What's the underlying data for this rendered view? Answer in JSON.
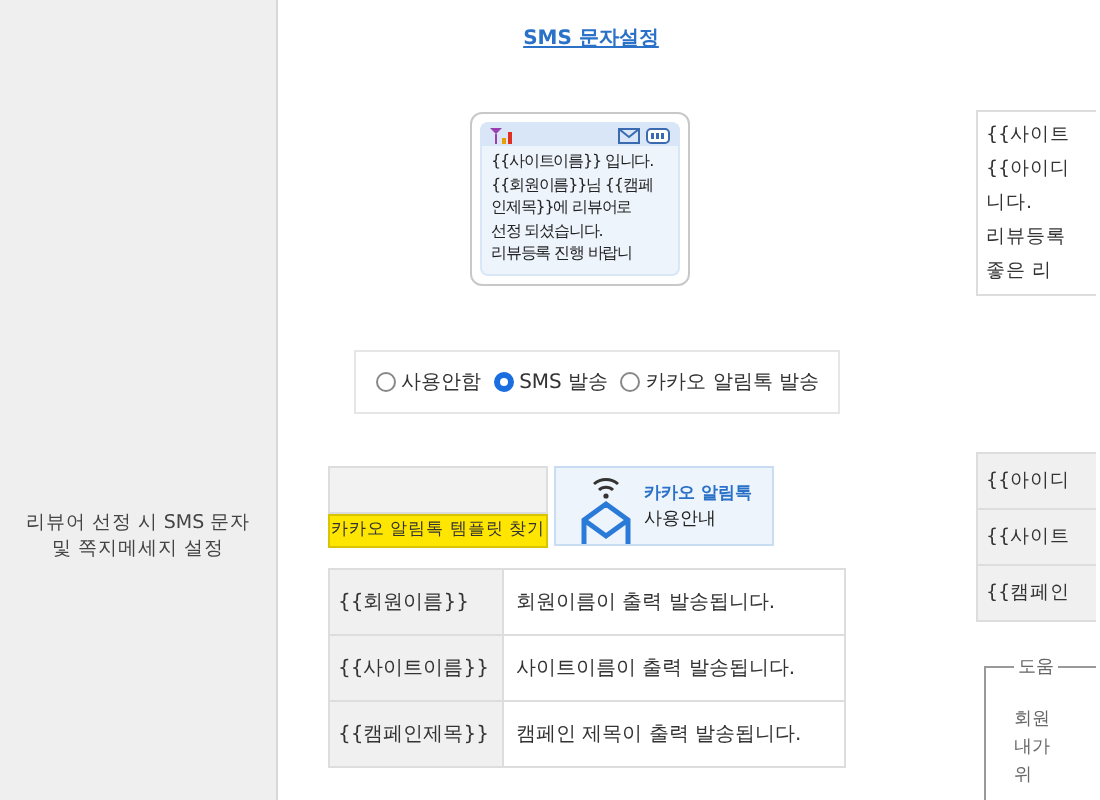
{
  "row_label": "리뷰어 선정 시 SMS 문자\n및 쪽지메세지 설정",
  "title": "SMS 문자설정",
  "sms_message": "{{사이트이름}} 입니다.\n{{회원이름}}님 {{캠페\n인제목}}에 리뷰어로\n선정 되셨습니다.\n리뷰등록 진행 바랍니",
  "send_options": [
    {
      "label": "사용안함",
      "selected": false
    },
    {
      "label": "SMS 발송",
      "selected": true
    },
    {
      "label": "카카오 알림톡 발송",
      "selected": false
    }
  ],
  "kakao_template_button": "카카오 알림톡 템플릿 찾기",
  "kakao_guide": {
    "title": "카카오 알림톡",
    "subtitle": "사용안내"
  },
  "variables": [
    {
      "code": "{{회원이름}}",
      "description": "회원이름이 출력 발송됩니다."
    },
    {
      "code": "{{사이트이름}}",
      "description": "사이트이름이 출력 발송됩니다."
    },
    {
      "code": "{{캠페인제목}}",
      "description": "캠페인 제목이 출력 발송됩니다."
    }
  ],
  "right_message_lines": [
    "{{사이트",
    "{{아이디",
    "니다.",
    "리뷰등록",
    "좋은 리"
  ],
  "right_variables": [
    "{{아이디",
    "{{사이트",
    "{{캠페인"
  ],
  "help": {
    "title": "도움",
    "lines": [
      "회원",
      "내가",
      "위"
    ]
  }
}
